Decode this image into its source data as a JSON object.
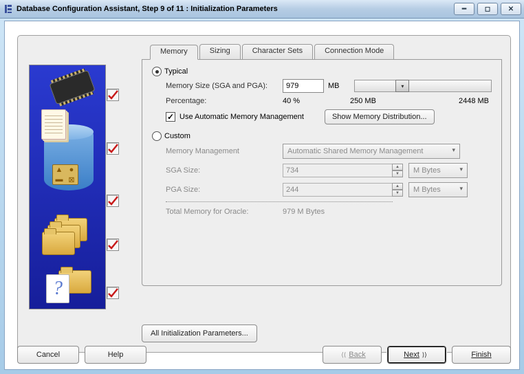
{
  "window": {
    "title": "Database Configuration Assistant, Step 9 of 11 : Initialization Parameters"
  },
  "tabs": {
    "memory": "Memory",
    "sizing": "Sizing",
    "charsets": "Character Sets",
    "connmode": "Connection Mode"
  },
  "typical": {
    "label": "Typical",
    "mem_label": "Memory Size (SGA and PGA):",
    "mem_value": "979",
    "mem_unit": "MB",
    "percentage_label": "Percentage:",
    "percentage_value": "40 %",
    "range_min": "250 MB",
    "range_max": "2448 MB",
    "auto_label": "Use Automatic Memory Management",
    "show_dist": "Show Memory Distribution..."
  },
  "custom": {
    "label": "Custom",
    "mm_label": "Memory Management",
    "mm_value": "Automatic Shared Memory Management",
    "sga_label": "SGA Size:",
    "sga_value": "734",
    "pga_label": "PGA Size:",
    "pga_value": "244",
    "unit": "M Bytes",
    "total_label": "Total Memory for Oracle:",
    "total_value": "979 M Bytes"
  },
  "buttons": {
    "all_params": "All Initialization Parameters...",
    "cancel": "Cancel",
    "help": "Help",
    "back": "Back",
    "next": "Next",
    "finish": "Finish"
  }
}
